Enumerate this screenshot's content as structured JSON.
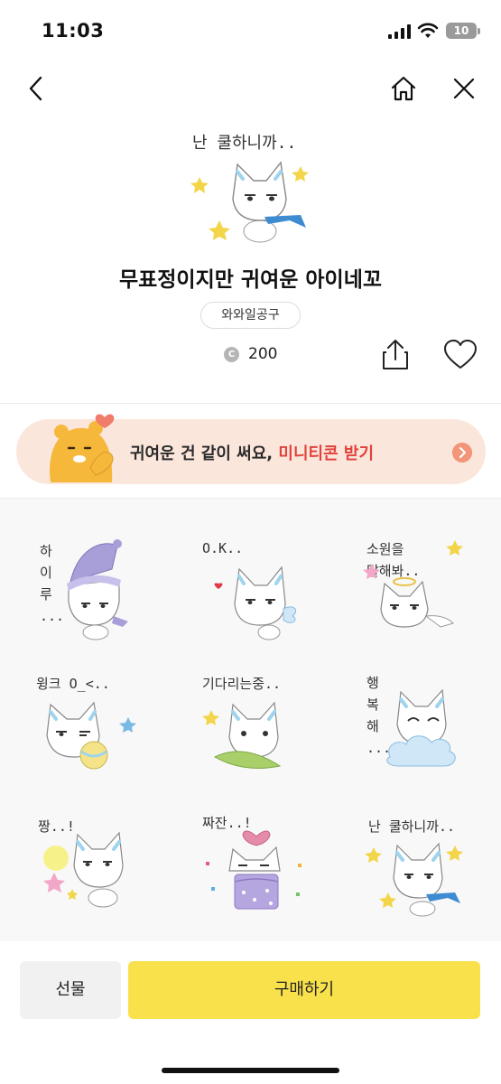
{
  "status_bar": {
    "time": "11:03",
    "battery": "10"
  },
  "nav": {
    "back_icon": "chevron-left-icon",
    "home_icon": "home-icon",
    "close_icon": "close-icon"
  },
  "product": {
    "hero_caption": "난 쿨하니까..",
    "title": "무표정이지만 귀여운 아이네꼬",
    "author": "와와일공구",
    "price": "200",
    "coin_symbol": "C"
  },
  "promo": {
    "text": "귀여운 건 같이 써요,",
    "highlight": "미니티콘 받기",
    "highlight_color": "#e2423b",
    "background": "#fbe6dc"
  },
  "stickers": [
    {
      "caption": "하\n이\n루\n..."
    },
    {
      "caption": "O.K.."
    },
    {
      "caption": "소원을\n말해봐.."
    },
    {
      "caption": "윙크  O_<.."
    },
    {
      "caption": "기다리는중.."
    },
    {
      "caption": "행\n복\n해\n..."
    },
    {
      "caption": "짱..!"
    },
    {
      "caption": "짜잔..!"
    },
    {
      "caption": "난 쿨하니까.."
    }
  ],
  "bottom": {
    "gift_label": "선물",
    "buy_label": "구매하기",
    "buy_color": "#f9e14b"
  }
}
